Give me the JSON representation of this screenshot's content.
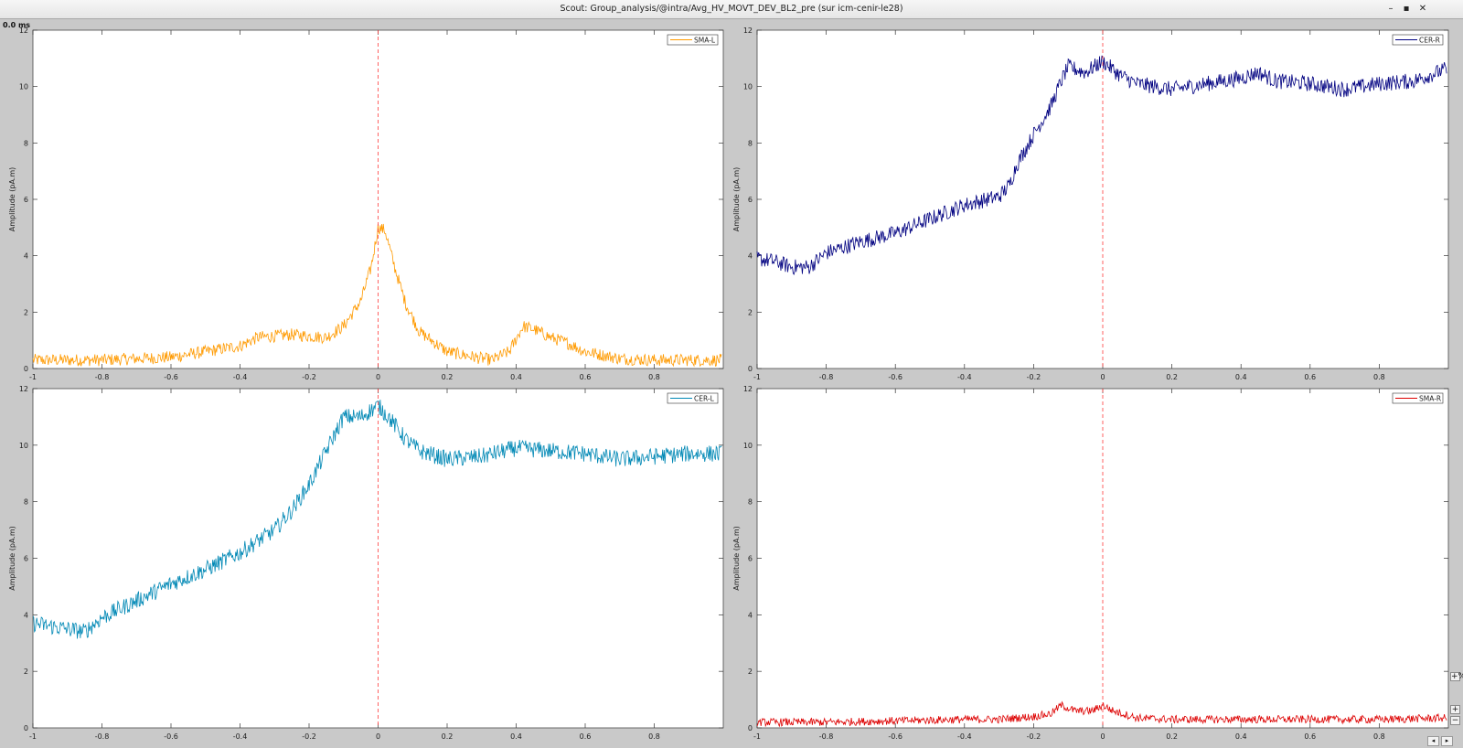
{
  "window": {
    "title": "Scout: Group_analysis/@intra/Avg_HV_MOVT_DEV_BL2_pre (sur icm-cenir-le28)",
    "minimize_label": "–",
    "maximize_label": "▪",
    "close_label": "✕"
  },
  "time_cursor_label": "0.0 ms",
  "side_buttons": {
    "zoom_label": "+%",
    "plus_label": "+",
    "minus_label": "−"
  },
  "nav_buttons": {
    "left_label": "◂",
    "right_label": "▸"
  },
  "colors": {
    "SMA-L": "#ff9a00",
    "CER-R": "#000080",
    "CER-L": "#0088b5",
    "SMA-R": "#dd0000",
    "cursor_line": "#ff3b3b"
  },
  "chart_data": [
    {
      "type": "line",
      "panel": "top-left",
      "series": [
        {
          "name": "SMA-L",
          "color": "#ff9a00"
        }
      ],
      "legend": "SMA-L",
      "legend_position": "top-right",
      "ylabel": "Amplitude (pA.m)",
      "xlim": [
        -1,
        1
      ],
      "ylim": [
        0,
        12
      ],
      "xticks": [
        "-1",
        "-0.8",
        "-0.6",
        "-0.4",
        "-0.2",
        "0",
        "0.2",
        "0.4",
        "0.6",
        "0.8"
      ],
      "yticks": [
        "0",
        "2",
        "4",
        "6",
        "8",
        "10",
        "12"
      ],
      "cursor_x": 0,
      "noise": 0.22,
      "keypoints": [
        [
          -1,
          0.3
        ],
        [
          -0.9,
          0.3
        ],
        [
          -0.8,
          0.3
        ],
        [
          -0.6,
          0.4
        ],
        [
          -0.5,
          0.6
        ],
        [
          -0.4,
          0.8
        ],
        [
          -0.35,
          1.1
        ],
        [
          -0.25,
          1.2
        ],
        [
          -0.15,
          1.1
        ],
        [
          -0.1,
          1.5
        ],
        [
          -0.05,
          2.4
        ],
        [
          -0.02,
          3.6
        ],
        [
          0,
          5.0
        ],
        [
          0.02,
          4.9
        ],
        [
          0.05,
          3.5
        ],
        [
          0.08,
          2.3
        ],
        [
          0.12,
          1.3
        ],
        [
          0.2,
          0.6
        ],
        [
          0.28,
          0.4
        ],
        [
          0.33,
          0.3
        ],
        [
          0.38,
          0.6
        ],
        [
          0.42,
          1.5
        ],
        [
          0.45,
          1.4
        ],
        [
          0.5,
          1.1
        ],
        [
          0.55,
          0.9
        ],
        [
          0.6,
          0.6
        ],
        [
          0.7,
          0.35
        ],
        [
          0.8,
          0.3
        ],
        [
          0.9,
          0.3
        ],
        [
          0.99,
          0.3
        ]
      ]
    },
    {
      "type": "line",
      "panel": "top-right",
      "series": [
        {
          "name": "CER-R",
          "color": "#000080"
        }
      ],
      "legend": "CER-R",
      "legend_position": "top-right",
      "ylabel": "Amplitude (pA.m)",
      "xlim": [
        -1,
        1
      ],
      "ylim": [
        0,
        12
      ],
      "xticks": [
        "-1",
        "-0.8",
        "-0.6",
        "-0.4",
        "-0.2",
        "0",
        "0.2",
        "0.4",
        "0.6",
        "0.8"
      ],
      "yticks": [
        "0",
        "2",
        "4",
        "6",
        "8",
        "10",
        "12"
      ],
      "cursor_x": 0,
      "noise": 0.28,
      "keypoints": [
        [
          -1,
          3.9
        ],
        [
          -0.95,
          3.8
        ],
        [
          -0.9,
          3.6
        ],
        [
          -0.85,
          3.6
        ],
        [
          -0.8,
          4.1
        ],
        [
          -0.7,
          4.5
        ],
        [
          -0.6,
          4.8
        ],
        [
          -0.5,
          5.3
        ],
        [
          -0.4,
          5.8
        ],
        [
          -0.3,
          6.1
        ],
        [
          -0.27,
          6.5
        ],
        [
          -0.25,
          7.2
        ],
        [
          -0.2,
          8.3
        ],
        [
          -0.15,
          9.3
        ],
        [
          -0.12,
          10.2
        ],
        [
          -0.1,
          10.7
        ],
        [
          -0.05,
          10.5
        ],
        [
          0,
          10.9
        ],
        [
          0.05,
          10.4
        ],
        [
          0.1,
          10.1
        ],
        [
          0.2,
          9.9
        ],
        [
          0.3,
          10.1
        ],
        [
          0.4,
          10.3
        ],
        [
          0.45,
          10.5
        ],
        [
          0.5,
          10.2
        ],
        [
          0.6,
          10.1
        ],
        [
          0.7,
          9.9
        ],
        [
          0.8,
          10.1
        ],
        [
          0.9,
          10.2
        ],
        [
          0.99,
          10.6
        ]
      ]
    },
    {
      "type": "line",
      "panel": "bottom-left",
      "series": [
        {
          "name": "CER-L",
          "color": "#0088b5"
        }
      ],
      "legend": "CER-L",
      "legend_position": "top-right",
      "ylabel": "Amplitude (pA.m)",
      "xlim": [
        -1,
        1
      ],
      "ylim": [
        0,
        12
      ],
      "xticks": [
        "-1",
        "-0.8",
        "-0.6",
        "-0.4",
        "-0.2",
        "0",
        "0.2",
        "0.4",
        "0.6",
        "0.8"
      ],
      "yticks": [
        "0",
        "2",
        "4",
        "6",
        "8",
        "10",
        "12"
      ],
      "cursor_x": 0,
      "noise": 0.3,
      "keypoints": [
        [
          -1,
          3.7
        ],
        [
          -0.95,
          3.6
        ],
        [
          -0.9,
          3.5
        ],
        [
          -0.85,
          3.4
        ],
        [
          -0.8,
          3.9
        ],
        [
          -0.7,
          4.5
        ],
        [
          -0.6,
          5.1
        ],
        [
          -0.5,
          5.6
        ],
        [
          -0.4,
          6.2
        ],
        [
          -0.3,
          7.0
        ],
        [
          -0.25,
          7.7
        ],
        [
          -0.2,
          8.6
        ],
        [
          -0.15,
          9.8
        ],
        [
          -0.1,
          11.0
        ],
        [
          -0.05,
          11.0
        ],
        [
          0,
          11.4
        ],
        [
          0.03,
          11.0
        ],
        [
          0.08,
          10.2
        ],
        [
          0.12,
          9.8
        ],
        [
          0.2,
          9.5
        ],
        [
          0.3,
          9.6
        ],
        [
          0.4,
          9.9
        ],
        [
          0.5,
          9.8
        ],
        [
          0.6,
          9.7
        ],
        [
          0.7,
          9.5
        ],
        [
          0.8,
          9.6
        ],
        [
          0.9,
          9.7
        ],
        [
          0.99,
          9.7
        ]
      ]
    },
    {
      "type": "line",
      "panel": "bottom-right",
      "series": [
        {
          "name": "SMA-R",
          "color": "#dd0000"
        }
      ],
      "legend": "SMA-R",
      "legend_position": "top-right",
      "ylabel": "Amplitude (pA.m)",
      "xlim": [
        -1,
        1
      ],
      "ylim": [
        0,
        12
      ],
      "xticks": [
        "-1",
        "-0.8",
        "-0.6",
        "-0.4",
        "-0.2",
        "0",
        "0.2",
        "0.4",
        "0.6",
        "0.8"
      ],
      "yticks": [
        "0",
        "2",
        "4",
        "6",
        "8",
        "10",
        "12"
      ],
      "cursor_x": 0,
      "noise": 0.14,
      "keypoints": [
        [
          -1,
          0.2
        ],
        [
          -0.8,
          0.2
        ],
        [
          -0.6,
          0.25
        ],
        [
          -0.4,
          0.3
        ],
        [
          -0.3,
          0.3
        ],
        [
          -0.2,
          0.4
        ],
        [
          -0.15,
          0.5
        ],
        [
          -0.12,
          0.8
        ],
        [
          -0.08,
          0.6
        ],
        [
          -0.03,
          0.6
        ],
        [
          0,
          0.8
        ],
        [
          0.03,
          0.6
        ],
        [
          0.1,
          0.35
        ],
        [
          0.2,
          0.3
        ],
        [
          0.4,
          0.3
        ],
        [
          0.6,
          0.3
        ],
        [
          0.8,
          0.3
        ],
        [
          0.99,
          0.35
        ]
      ]
    }
  ]
}
